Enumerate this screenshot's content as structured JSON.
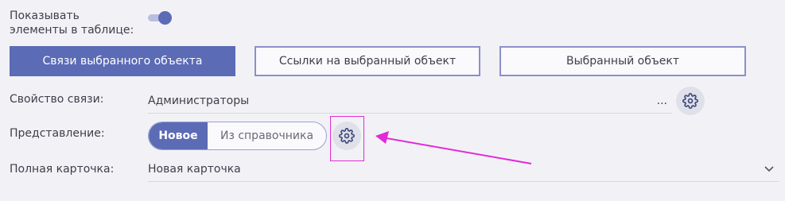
{
  "settings": {
    "show_in_table_label_line1": "Показывать",
    "show_in_table_label_line2": "элементы в таблице:",
    "show_in_table_enabled": true
  },
  "tabs": [
    {
      "label": "Связи выбранного объекта",
      "active": true
    },
    {
      "label": "Ссылки на выбранный объект",
      "active": false
    },
    {
      "label": "Выбранный объект",
      "active": false
    }
  ],
  "link_property": {
    "label": "Свойство связи:",
    "value": "Администраторы",
    "more": "..."
  },
  "view": {
    "label": "Представление:",
    "options": [
      "Новое",
      "Из справочника"
    ],
    "selected": "Новое"
  },
  "full_card": {
    "label": "Полная карточка:",
    "value": "Новая карточка"
  },
  "colors": {
    "accent": "#5c6bb5",
    "annotation": "#e22ad8"
  }
}
